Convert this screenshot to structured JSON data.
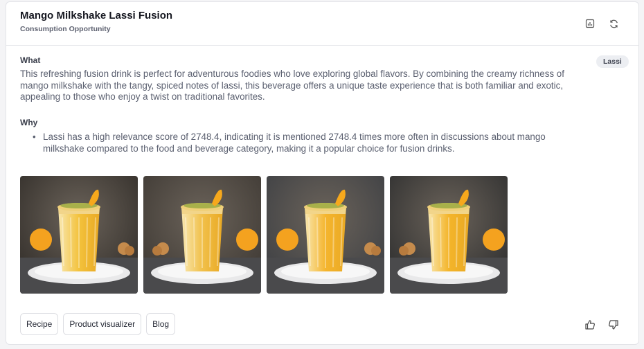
{
  "header": {
    "title": "Mango Milkshake Lassi Fusion",
    "subtitle": "Consumption Opportunity",
    "icons": [
      "chart-icon",
      "refresh-icon"
    ]
  },
  "what": {
    "label": "What",
    "text": "This refreshing fusion drink is perfect for adventurous foodies who love exploring global flavors. By combining the creamy richness of mango milkshake with the tangy, spiced notes of lassi, this beverage offers a unique taste experience that is both familiar and exotic, appealing to those who enjoy a twist on traditional favorites."
  },
  "tag": {
    "label": "Lassi",
    "color": "#eceef2"
  },
  "why": {
    "label": "Why",
    "bullet": "•",
    "items": [
      "Lassi has a high relevance score of 2748.4, indicating it is mentioned 2748.4 times more often in discussions about mango milkshake compared to the food and beverage category, making it a popular choice for fusion drinks."
    ]
  },
  "images": [
    {
      "name": "mango-lassi-image-1",
      "bg": "#2e2a26",
      "drink": "#f3c23c"
    },
    {
      "name": "mango-lassi-image-2",
      "bg": "#3b3631",
      "drink": "#f1c04a"
    },
    {
      "name": "mango-lassi-image-3",
      "bg": "#3a3d42",
      "drink": "#f5b52e"
    },
    {
      "name": "mango-lassi-image-4",
      "bg": "#2a2b2c",
      "drink": "#f4b52a"
    }
  ],
  "actions": {
    "recipe": "Recipe",
    "product_visualizer": "Product visualizer",
    "blog": "Blog"
  },
  "feedback": {
    "icons": [
      "thumbs-up-icon",
      "thumbs-down-icon"
    ]
  },
  "colors": {
    "accent": "#f3c23c",
    "text_muted": "#5b6070",
    "border": "#e3e4e8"
  }
}
